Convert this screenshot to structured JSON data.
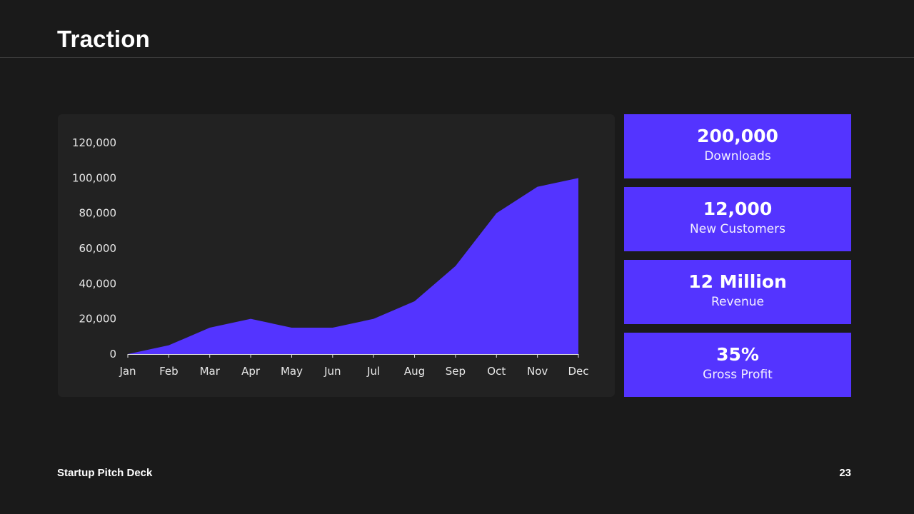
{
  "slide": {
    "title": "Traction",
    "footer_label": "Startup Pitch Deck",
    "page_number": "23"
  },
  "colors": {
    "background": "#1a1a1a",
    "panel": "#222222",
    "accent": "#5434ff"
  },
  "stats": [
    {
      "value": "200,000",
      "label": "Downloads"
    },
    {
      "value": "12,000",
      "label": "New Customers"
    },
    {
      "value": "12 Million",
      "label": "Revenue"
    },
    {
      "value": "35%",
      "label": "Gross Profit"
    }
  ],
  "chart_data": {
    "type": "area",
    "categories": [
      "Jan",
      "Feb",
      "Mar",
      "Apr",
      "May",
      "Jun",
      "Jul",
      "Aug",
      "Sep",
      "Oct",
      "Nov",
      "Dec"
    ],
    "values": [
      0,
      5000,
      15000,
      20000,
      15000,
      15000,
      20000,
      30000,
      50000,
      80000,
      95000,
      100000
    ],
    "ylim": [
      0,
      120000
    ],
    "yticks": [
      "0",
      "20,000",
      "40,000",
      "60,000",
      "80,000",
      "100,000",
      "120,000"
    ],
    "xlabel": "",
    "ylabel": "",
    "grid": false,
    "legend": "none",
    "color": "#5434ff"
  }
}
